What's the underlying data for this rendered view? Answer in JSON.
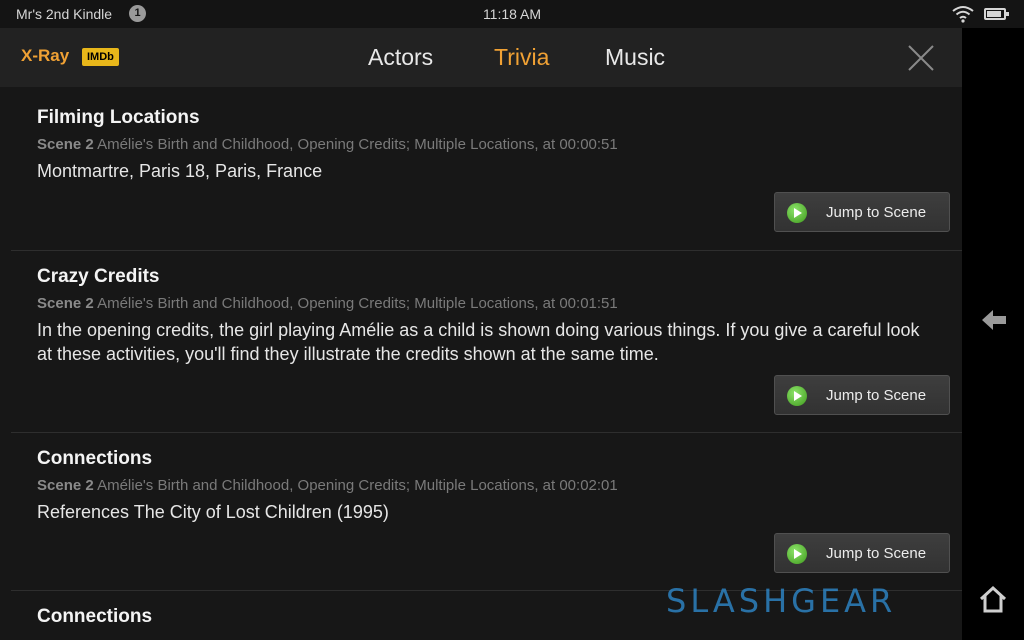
{
  "status_bar": {
    "device_name": "Mr's 2nd Kindle",
    "notification_count": "1",
    "time": "11:18 AM",
    "icons": [
      "wifi-icon",
      "battery-icon"
    ],
    "battery_level": 0.85
  },
  "header": {
    "title": "X-Ray",
    "badge": "IMDb",
    "tabs": [
      {
        "label": "Actors",
        "active": false
      },
      {
        "label": "Trivia",
        "active": true
      },
      {
        "label": "Music",
        "active": false
      }
    ],
    "close_icon": "close-icon"
  },
  "entries": [
    {
      "title": "Filming Locations",
      "scene_label": "Scene 2",
      "scene_detail": "Amélie's Birth and Childhood, Opening Credits; Multiple Locations, at 00:00:51",
      "body": "Montmartre, Paris 18, Paris, France",
      "button": "Jump to Scene"
    },
    {
      "title": "Crazy Credits",
      "scene_label": "Scene 2",
      "scene_detail": "Amélie's Birth and Childhood, Opening Credits; Multiple Locations, at 00:01:51",
      "body": "In the opening credits, the girl playing Amélie as a child is shown doing various things. If you give a careful look at these activities, you'll find they illustrate the credits shown at the same time.",
      "button": "Jump to Scene"
    },
    {
      "title": "Connections",
      "scene_label": "Scene 2",
      "scene_detail": "Amélie's Birth and Childhood, Opening Credits; Multiple Locations, at 00:02:01",
      "body": "References The City of Lost Children (1995)",
      "button": "Jump to Scene"
    },
    {
      "title": "Connections"
    }
  ],
  "side_controls": {
    "back_icon": "back-arrow-icon",
    "home_icon": "home-icon"
  },
  "watermark": "SLASHGEAR",
  "colors": {
    "accent": "#f0a134",
    "imdb": "#e8b71a",
    "play_green": "#5bc236",
    "background": "#171717"
  }
}
